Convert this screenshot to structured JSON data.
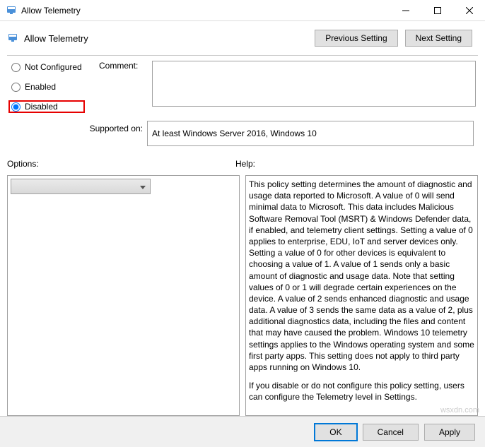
{
  "window": {
    "title": "Allow Telemetry"
  },
  "header": {
    "title": "Allow Telemetry",
    "prev": "Previous Setting",
    "next": "Next Setting"
  },
  "radios": {
    "not_configured": "Not Configured",
    "enabled": "Enabled",
    "disabled": "Disabled",
    "selected": "disabled"
  },
  "comment": {
    "label": "Comment:",
    "value": ""
  },
  "supported": {
    "label": "Supported on:",
    "value": "At least Windows Server 2016, Windows 10"
  },
  "labels": {
    "options": "Options:",
    "help": "Help:"
  },
  "help": {
    "p1": "This policy setting determines the amount of diagnostic and usage data reported to Microsoft. A value of 0 will send minimal data to Microsoft. This data includes Malicious Software Removal Tool (MSRT) & Windows Defender data, if enabled, and telemetry client settings. Setting a value of 0 applies to enterprise, EDU, IoT and server devices only. Setting a value of 0 for other devices is equivalent to choosing a value of 1. A value of 1 sends only a basic amount of diagnostic and usage data. Note that setting values of 0 or 1 will degrade certain experiences on the device. A value of 2 sends enhanced diagnostic and usage data. A value of 3 sends the same data as a value of 2, plus additional diagnostics data, including the files and content that may have caused the problem. Windows 10 telemetry settings applies to the Windows operating system and some first party apps. This setting does not apply to third party apps running on Windows 10.",
    "p2": "If you disable or do not configure this policy setting, users can configure the Telemetry level in Settings."
  },
  "footer": {
    "ok": "OK",
    "cancel": "Cancel",
    "apply": "Apply"
  },
  "watermark": "wsxdn.com"
}
